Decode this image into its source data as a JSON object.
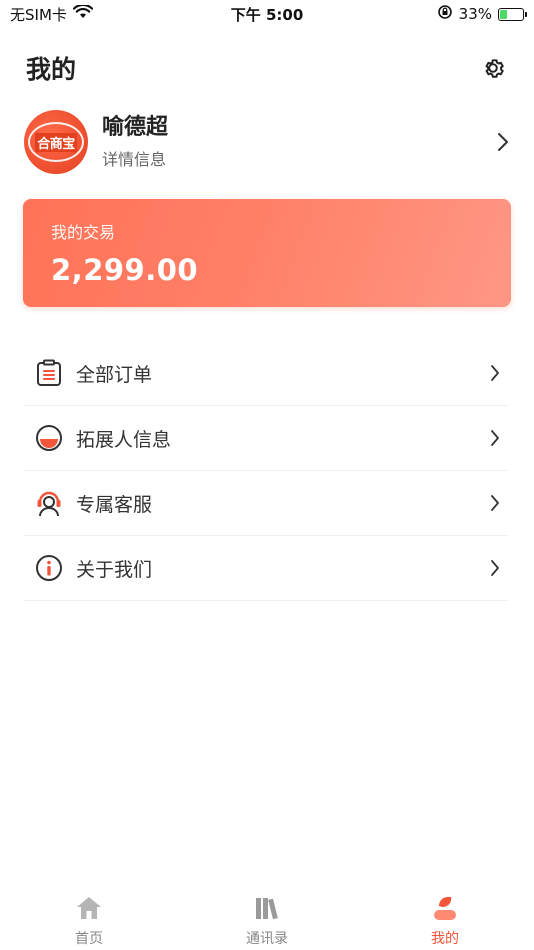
{
  "status_bar": {
    "carrier": "无SIM卡",
    "time": "下午 5:00",
    "battery": "33%"
  },
  "header": {
    "title": "我的",
    "settings_icon": "gear-icon"
  },
  "profile": {
    "avatar_text": "合商宝",
    "name": "喻德超",
    "subtitle": "详情信息"
  },
  "transaction": {
    "label": "我的交易",
    "amount": "2,299.00"
  },
  "menu": {
    "items": [
      {
        "label": "全部订单",
        "icon": "clipboard-icon"
      },
      {
        "label": "拓展人信息",
        "icon": "half-circle-icon"
      },
      {
        "label": "专属客服",
        "icon": "headset-icon"
      },
      {
        "label": "关于我们",
        "icon": "info-icon"
      }
    ]
  },
  "tabs": [
    {
      "label": "首页",
      "icon": "home-icon",
      "active": false
    },
    {
      "label": "通讯录",
      "icon": "books-icon",
      "active": false
    },
    {
      "label": "我的",
      "icon": "profile-icon",
      "active": true
    }
  ],
  "colors": {
    "accent": "#f2553a",
    "card_start": "#ff7358",
    "card_end": "#ff9785",
    "inactive_tab": "#b5b5b5"
  }
}
